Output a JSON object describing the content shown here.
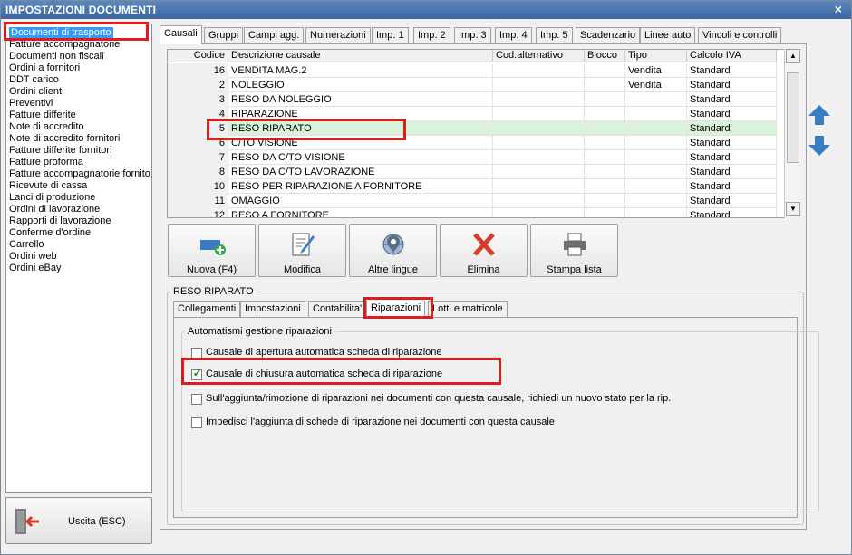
{
  "window": {
    "title": "IMPOSTAZIONI DOCUMENTI",
    "close_glyph": "×"
  },
  "sidebar": {
    "items": [
      {
        "label": "Documenti di trasporto",
        "selected": true
      },
      {
        "label": "Fatture accompagnatorie"
      },
      {
        "label": "Documenti non fiscali"
      },
      {
        "label": "Ordini a fornitori"
      },
      {
        "label": "DDT carico"
      },
      {
        "label": "Ordini clienti"
      },
      {
        "label": "Preventivi"
      },
      {
        "label": "Fatture differite"
      },
      {
        "label": "Note di accredito"
      },
      {
        "label": "Note di accredito fornitori"
      },
      {
        "label": "Fatture differite fornitori"
      },
      {
        "label": "Fatture proforma"
      },
      {
        "label": "Fatture accompagnatorie fornito"
      },
      {
        "label": "Ricevute di cassa"
      },
      {
        "label": "Lanci di produzione"
      },
      {
        "label": "Ordini di lavorazione"
      },
      {
        "label": "Rapporti di lavorazione"
      },
      {
        "label": "Conferme d'ordine"
      },
      {
        "label": "Carrello"
      },
      {
        "label": "Ordini web"
      },
      {
        "label": "Ordini eBay"
      }
    ],
    "exit_label": "Uscita (ESC)"
  },
  "main_tabs": [
    {
      "label": "Causali",
      "active": true
    },
    {
      "label": "Gruppi"
    },
    {
      "label": "Campi agg."
    },
    {
      "label": "Numerazioni"
    },
    {
      "label": "Imp. 1"
    },
    {
      "label": "Imp. 2"
    },
    {
      "label": "Imp. 3"
    },
    {
      "label": "Imp. 4"
    },
    {
      "label": "Imp. 5"
    },
    {
      "label": "Scadenzario"
    },
    {
      "label": "Linee auto"
    },
    {
      "label": "Vincoli e controlli"
    }
  ],
  "table": {
    "columns": [
      "Codice",
      "Descrizione causale",
      "Cod.alternativo",
      "Blocco",
      "Tipo",
      "Calcolo IVA"
    ],
    "rows": [
      {
        "codice": "16",
        "descrizione": "VENDITA MAG.2",
        "cod_alt": "",
        "blocco": "",
        "tipo": "Vendita",
        "iva": "Standard"
      },
      {
        "codice": "2",
        "descrizione": "NOLEGGIO",
        "cod_alt": "",
        "blocco": "",
        "tipo": "Vendita",
        "iva": "Standard"
      },
      {
        "codice": "3",
        "descrizione": "RESO DA NOLEGGIO",
        "cod_alt": "",
        "blocco": "",
        "tipo": "",
        "iva": "Standard"
      },
      {
        "codice": "4",
        "descrizione": "RIPARAZIONE",
        "cod_alt": "",
        "blocco": "",
        "tipo": "",
        "iva": "Standard"
      },
      {
        "codice": "5",
        "descrizione": "RESO RIPARATO",
        "cod_alt": "",
        "blocco": "",
        "tipo": "",
        "iva": "Standard",
        "selected": true
      },
      {
        "codice": "6",
        "descrizione": "C/TO VISIONE",
        "cod_alt": "",
        "blocco": "",
        "tipo": "",
        "iva": "Standard"
      },
      {
        "codice": "7",
        "descrizione": "RESO DA C/TO VISIONE",
        "cod_alt": "",
        "blocco": "",
        "tipo": "",
        "iva": "Standard"
      },
      {
        "codice": "8",
        "descrizione": "RESO DA C/TO LAVORAZIONE",
        "cod_alt": "",
        "blocco": "",
        "tipo": "",
        "iva": "Standard"
      },
      {
        "codice": "10",
        "descrizione": "RESO PER RIPARAZIONE A FORNITORE",
        "cod_alt": "",
        "blocco": "",
        "tipo": "",
        "iva": "Standard"
      },
      {
        "codice": "11",
        "descrizione": "OMAGGIO",
        "cod_alt": "",
        "blocco": "",
        "tipo": "",
        "iva": "Standard"
      },
      {
        "codice": "12",
        "descrizione": "RESO A FORNITORE",
        "cod_alt": "",
        "blocco": "",
        "tipo": "",
        "iva": "Standard"
      }
    ]
  },
  "toolbar": {
    "new_label": "Nuova (F4)",
    "edit_label": "Modifica",
    "languages_label": "Altre lingue",
    "delete_label": "Elimina",
    "print_label": "Stampa lista"
  },
  "detail": {
    "group_title": "RESO RIPARATO",
    "tabs": [
      {
        "label": "Collegamenti"
      },
      {
        "label": "Impostazioni"
      },
      {
        "label": "Contabilita'"
      },
      {
        "label": "Riparazioni",
        "active": true
      },
      {
        "label": "Lotti e matricole"
      }
    ],
    "automation_title": "Automatismi gestione riparazioni",
    "options": [
      {
        "label": "Causale di apertura automatica scheda di riparazione",
        "checked": false
      },
      {
        "label": "Causale di chiusura automatica scheda di riparazione",
        "checked": true
      },
      {
        "label": "Sull'aggiunta/rimozione di riparazioni nei documenti con questa causale, richiedi un nuovo stato per la rip.",
        "checked": false
      },
      {
        "label": "Impedisci l'aggiunta di schede di riparazione nei documenti con questa causale",
        "checked": false
      }
    ]
  },
  "colors": {
    "accent": "#3399ff",
    "highlight_box": "#e01b1b",
    "selected_row": "#d9f2d9",
    "arrow": "#3a7cc4"
  }
}
